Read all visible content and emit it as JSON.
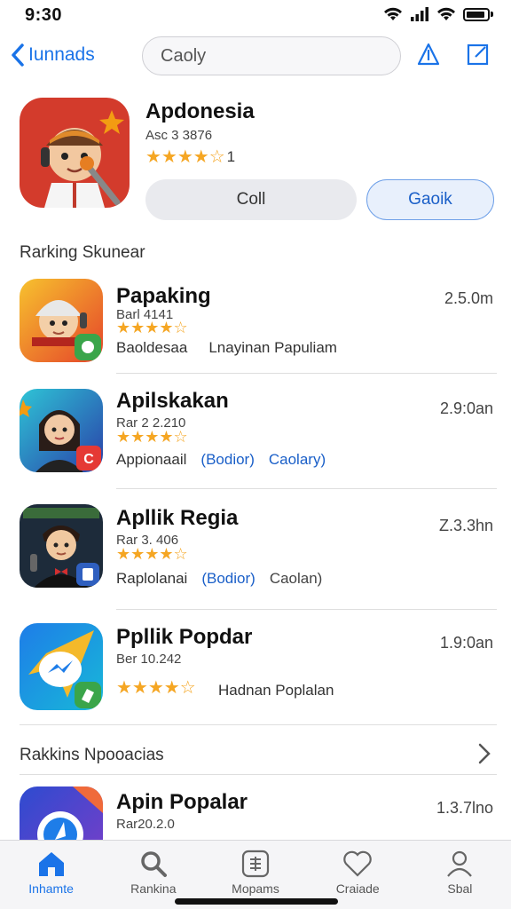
{
  "status": {
    "time": "9:30"
  },
  "nav": {
    "back_label": "Iunnads",
    "search_value": "Caoly"
  },
  "featured": {
    "title": "Apdonesia",
    "subtitle": "Asc 3 3876",
    "stars": "★★★★☆",
    "rating_suffix": "1",
    "btn_left": "Coll",
    "btn_right": "Gaoik"
  },
  "section1": {
    "title": "Rarking Skunear"
  },
  "apps": [
    {
      "title": "Papaking",
      "code": "Barl 4141",
      "stars": "★★★★☆",
      "tag1": "Baoldesaa",
      "tag2": "Lnayinan Papuliam",
      "tag3": "",
      "size": "2.5.0m"
    },
    {
      "title": "Apilskakan",
      "code": "Rar 2 2.210",
      "stars": "★★★★☆",
      "tag1": "Appionaail",
      "tag2": "(Bodior)",
      "tag3": "Caolary)",
      "size": "2.9:0an"
    },
    {
      "title": "Apllik Regia",
      "code": "Rar 3. 406",
      "stars": "★★★★☆",
      "tag1": "Raplolanai",
      "tag2": "(Bodior)",
      "tag3": "Caolan)",
      "size": "Z.3.3hn"
    },
    {
      "title": "Ppllik Popdar",
      "code": "Ber 10.242",
      "stars": "★★★★☆",
      "tag1": "Hadnan Poplalan",
      "tag2": "",
      "tag3": "",
      "size": "1.9:0an"
    }
  ],
  "section2": {
    "title": "Rakkins Npooacias"
  },
  "next_app": {
    "title": "Apin Popalar",
    "code": "Rar20.2.0",
    "size": "1.3.7lno"
  },
  "tabs": [
    {
      "label": "Inhamte",
      "icon": "home-icon"
    },
    {
      "label": "Rankina",
      "icon": "search-icon"
    },
    {
      "label": "Mopams",
      "icon": "calculator-icon"
    },
    {
      "label": "Craiade",
      "icon": "heart-icon"
    },
    {
      "label": "Sbal",
      "icon": "person-icon"
    }
  ],
  "colors": {
    "accent": "#1a73e8",
    "star": "#f5a623"
  }
}
